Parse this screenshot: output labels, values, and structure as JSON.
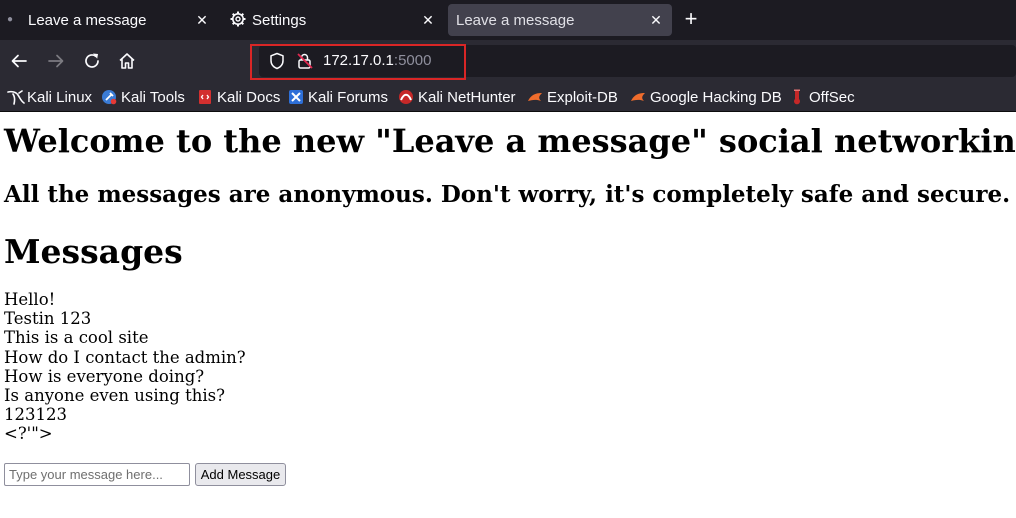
{
  "tabs": [
    {
      "title": "Leave a message",
      "close": "✕"
    },
    {
      "title": "Settings",
      "close": "✕"
    },
    {
      "title": "Leave a message",
      "close": "✕"
    }
  ],
  "new_tab_label": "+",
  "address_bar": {
    "host": "172.17.0.1",
    "port": ":5000"
  },
  "bookmarks": [
    {
      "label": "Kali Linux",
      "icon": "kali-dragon-icon"
    },
    {
      "label": "Kali Tools",
      "icon": "kali-tools-icon"
    },
    {
      "label": "Kali Docs",
      "icon": "kali-docs-icon"
    },
    {
      "label": "Kali Forums",
      "icon": "kali-forums-icon"
    },
    {
      "label": "Kali NetHunter",
      "icon": "kali-nethunter-icon"
    },
    {
      "label": "Exploit-DB",
      "icon": "exploit-db-icon"
    },
    {
      "label": "Google Hacking DB",
      "icon": "ghdb-icon"
    },
    {
      "label": "OffSec",
      "icon": "offsec-icon"
    }
  ],
  "page": {
    "title": "Welcome to the new \"Leave a message\" social networking site!",
    "subtitle": "All the messages are anonymous. Don't worry, it's completely safe and secure.",
    "messages_heading": "Messages",
    "messages": [
      "Hello!",
      "Testin 123",
      "This is a cool site",
      "How do I contact the admin?",
      "How is everyone doing?",
      "Is anyone even using this?",
      "123123",
      "<?'\">"
    ],
    "input_placeholder": "Type your message here...",
    "add_button_label": "Add Message"
  },
  "colors": {
    "highlight_border": "#d92626",
    "chrome_dark": "#1c1b22",
    "chrome": "#2b2a33"
  }
}
